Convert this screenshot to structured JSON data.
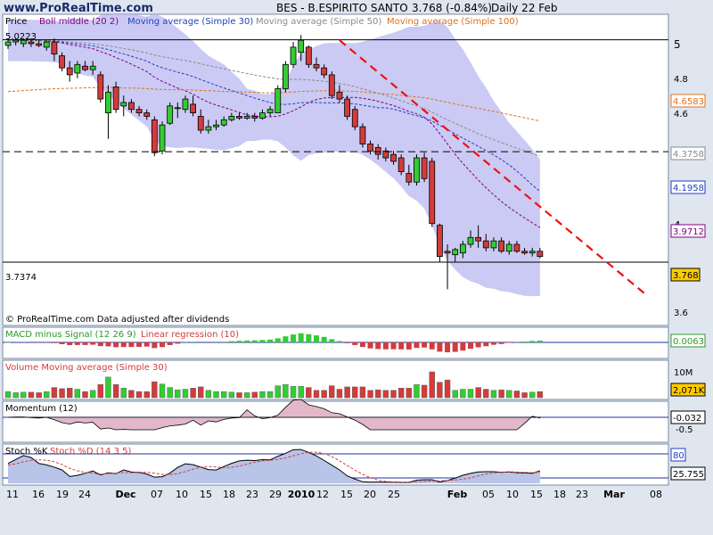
{
  "header": {
    "site": "www.ProRealTime.com",
    "ticker": "BES - B.ESPIRITO SANTO",
    "quote": "3.768 (-0.84%)",
    "period": "Daily  22 Feb"
  },
  "price_legend": [
    {
      "label": "Price",
      "color": "#000000"
    },
    {
      "label": "Boll middle (20 2)",
      "color": "#800080"
    },
    {
      "label": "Moving average (Simple 30)",
      "color": "#1f3fbf"
    },
    {
      "label": "Moving average (Simple 50)",
      "color": "#8a8a8a"
    },
    {
      "label": "Moving average (Simple 100)",
      "color": "#e0701a"
    }
  ],
  "price_labels": {
    "high_mark": "5.0223",
    "low_mark": "3.7374",
    "credit": "© ProRealTime.com  Data adjusted after dividends"
  },
  "price_axis": {
    "ticks": [
      "5",
      "4.8",
      "4.6",
      "4",
      "3.6"
    ],
    "ma100_tag": "4.6583",
    "ma50_tag": "4.3758",
    "ma30_tag": "4.1958",
    "boll_tag": "3.9712",
    "last_tag": "3.768"
  },
  "macd_panel": {
    "title1": "MACD minus Signal (12 26 9)",
    "title2": "Linear regression (10)",
    "value_tag": "0.0063"
  },
  "volume_panel": {
    "title": "Volume Moving average (Simple 30)",
    "tick": "10M",
    "value_tag": "2,071K"
  },
  "momentum_panel": {
    "title": "Momentum (12)",
    "value_tag": "-0.032",
    "tick": "-0.5"
  },
  "stoch_panel": {
    "title1": "Stoch %K",
    "title2": "Stoch %D (14 3 5)",
    "tag80": "80",
    "value_tag": "25.755"
  },
  "x_axis": {
    "labels": [
      "11",
      "16",
      "19",
      "24",
      "Dec",
      "07",
      "10",
      "15",
      "18",
      "23",
      "29",
      "2010",
      "12",
      "15",
      "20",
      "25",
      "Feb",
      "05",
      "10",
      "15",
      "18",
      "23",
      "Mar",
      "08"
    ]
  },
  "colors": {
    "up": "#33cc33",
    "down": "#d23c3c",
    "band": "#b8b8f0",
    "trend": "#ee1111",
    "ma30": "#1f3fbf",
    "ma50": "#8a8a8a",
    "ma100": "#e0701a",
    "boll": "#800080"
  },
  "chart_data": [
    {
      "type": "candlestick",
      "title": "BES - B.ESPIRITO SANTO",
      "ylim": [
        3.5,
        5.1
      ],
      "levels": [
        5.0223,
        4.3758,
        3.7374
      ],
      "candles": [
        {
          "o": 4.99,
          "h": 5.03,
          "l": 4.97,
          "c": 5.01
        },
        {
          "o": 5.01,
          "h": 5.03,
          "l": 4.99,
          "c": 5.02
        },
        {
          "o": 5.0,
          "h": 5.03,
          "l": 4.98,
          "c": 5.02
        },
        {
          "o": 5.01,
          "h": 5.03,
          "l": 4.98,
          "c": 5.0
        },
        {
          "o": 5.0,
          "h": 5.02,
          "l": 4.98,
          "c": 4.99
        },
        {
          "o": 4.98,
          "h": 5.02,
          "l": 4.96,
          "c": 5.01
        },
        {
          "o": 5.01,
          "h": 5.03,
          "l": 4.9,
          "c": 4.94
        },
        {
          "o": 4.93,
          "h": 4.95,
          "l": 4.84,
          "c": 4.86
        },
        {
          "o": 4.86,
          "h": 4.9,
          "l": 4.78,
          "c": 4.82
        },
        {
          "o": 4.83,
          "h": 4.9,
          "l": 4.8,
          "c": 4.88
        },
        {
          "o": 4.87,
          "h": 4.9,
          "l": 4.84,
          "c": 4.85
        },
        {
          "o": 4.85,
          "h": 4.9,
          "l": 4.82,
          "c": 4.87
        },
        {
          "o": 4.82,
          "h": 4.84,
          "l": 4.66,
          "c": 4.68
        },
        {
          "o": 4.6,
          "h": 4.76,
          "l": 4.45,
          "c": 4.72
        },
        {
          "o": 4.75,
          "h": 4.78,
          "l": 4.6,
          "c": 4.62
        },
        {
          "o": 4.64,
          "h": 4.7,
          "l": 4.58,
          "c": 4.66
        },
        {
          "o": 4.66,
          "h": 4.68,
          "l": 4.6,
          "c": 4.62
        },
        {
          "o": 4.62,
          "h": 4.64,
          "l": 4.58,
          "c": 4.6
        },
        {
          "o": 4.6,
          "h": 4.62,
          "l": 4.56,
          "c": 4.58
        },
        {
          "o": 4.56,
          "h": 4.58,
          "l": 4.35,
          "c": 4.37
        },
        {
          "o": 4.38,
          "h": 4.55,
          "l": 4.36,
          "c": 4.53
        },
        {
          "o": 4.54,
          "h": 4.66,
          "l": 4.53,
          "c": 4.64
        },
        {
          "o": 4.63,
          "h": 4.66,
          "l": 4.57,
          "c": 4.63
        },
        {
          "o": 4.62,
          "h": 4.7,
          "l": 4.6,
          "c": 4.68
        },
        {
          "o": 4.65,
          "h": 4.7,
          "l": 4.58,
          "c": 4.6
        },
        {
          "o": 4.58,
          "h": 4.62,
          "l": 4.48,
          "c": 4.5
        },
        {
          "o": 4.5,
          "h": 4.56,
          "l": 4.48,
          "c": 4.52
        },
        {
          "o": 4.52,
          "h": 4.56,
          "l": 4.5,
          "c": 4.53
        },
        {
          "o": 4.53,
          "h": 4.58,
          "l": 4.52,
          "c": 4.56
        },
        {
          "o": 4.56,
          "h": 4.6,
          "l": 4.55,
          "c": 4.58
        },
        {
          "o": 4.58,
          "h": 4.6,
          "l": 4.56,
          "c": 4.57
        },
        {
          "o": 4.57,
          "h": 4.6,
          "l": 4.56,
          "c": 4.58
        },
        {
          "o": 4.58,
          "h": 4.6,
          "l": 4.55,
          "c": 4.57
        },
        {
          "o": 4.57,
          "h": 4.62,
          "l": 4.56,
          "c": 4.6
        },
        {
          "o": 4.6,
          "h": 4.64,
          "l": 4.58,
          "c": 4.62
        },
        {
          "o": 4.6,
          "h": 4.76,
          "l": 4.6,
          "c": 4.74
        },
        {
          "o": 4.74,
          "h": 4.9,
          "l": 4.72,
          "c": 4.88
        },
        {
          "o": 4.88,
          "h": 5.01,
          "l": 4.86,
          "c": 4.98
        },
        {
          "o": 4.95,
          "h": 5.05,
          "l": 4.9,
          "c": 5.02
        },
        {
          "o": 4.98,
          "h": 4.99,
          "l": 4.86,
          "c": 4.88
        },
        {
          "o": 4.88,
          "h": 4.92,
          "l": 4.84,
          "c": 4.86
        },
        {
          "o": 4.86,
          "h": 4.88,
          "l": 4.8,
          "c": 4.82
        },
        {
          "o": 4.82,
          "h": 4.84,
          "l": 4.68,
          "c": 4.7
        },
        {
          "o": 4.72,
          "h": 4.76,
          "l": 4.66,
          "c": 4.68
        },
        {
          "o": 4.68,
          "h": 4.7,
          "l": 4.56,
          "c": 4.58
        },
        {
          "o": 4.62,
          "h": 4.64,
          "l": 4.5,
          "c": 4.52
        },
        {
          "o": 4.52,
          "h": 4.54,
          "l": 4.4,
          "c": 4.42
        },
        {
          "o": 4.42,
          "h": 4.44,
          "l": 4.36,
          "c": 4.38
        },
        {
          "o": 4.4,
          "h": 4.42,
          "l": 4.33,
          "c": 4.36
        },
        {
          "o": 4.38,
          "h": 4.4,
          "l": 4.32,
          "c": 4.34
        },
        {
          "o": 4.36,
          "h": 4.38,
          "l": 4.3,
          "c": 4.32
        },
        {
          "o": 4.34,
          "h": 4.36,
          "l": 4.24,
          "c": 4.26
        },
        {
          "o": 4.25,
          "h": 4.3,
          "l": 4.18,
          "c": 4.2
        },
        {
          "o": 4.2,
          "h": 4.36,
          "l": 4.18,
          "c": 4.34
        },
        {
          "o": 4.34,
          "h": 4.37,
          "l": 4.2,
          "c": 4.22
        },
        {
          "o": 4.32,
          "h": 4.34,
          "l": 3.94,
          "c": 3.96
        },
        {
          "o": 3.95,
          "h": 3.96,
          "l": 3.74,
          "c": 3.77
        },
        {
          "o": 3.8,
          "h": 3.84,
          "l": 3.58,
          "c": 3.79
        },
        {
          "o": 3.78,
          "h": 3.82,
          "l": 3.74,
          "c": 3.81
        },
        {
          "o": 3.79,
          "h": 3.86,
          "l": 3.76,
          "c": 3.84
        },
        {
          "o": 3.84,
          "h": 3.92,
          "l": 3.82,
          "c": 3.88
        },
        {
          "o": 3.88,
          "h": 3.95,
          "l": 3.82,
          "c": 3.86
        },
        {
          "o": 3.86,
          "h": 3.9,
          "l": 3.8,
          "c": 3.82
        },
        {
          "o": 3.82,
          "h": 3.88,
          "l": 3.8,
          "c": 3.86
        },
        {
          "o": 3.86,
          "h": 3.88,
          "l": 3.79,
          "c": 3.8
        },
        {
          "o": 3.8,
          "h": 3.86,
          "l": 3.78,
          "c": 3.84
        },
        {
          "o": 3.84,
          "h": 3.86,
          "l": 3.79,
          "c": 3.8
        },
        {
          "o": 3.8,
          "h": 3.82,
          "l": 3.78,
          "c": 3.79
        },
        {
          "o": 3.79,
          "h": 3.82,
          "l": 3.77,
          "c": 3.8
        },
        {
          "o": 3.8,
          "h": 3.82,
          "l": 3.76,
          "c": 3.77
        }
      ]
    }
  ]
}
